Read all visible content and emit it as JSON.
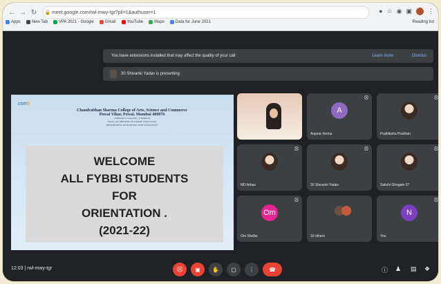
{
  "browser": {
    "url": "meet.google.com/rwl-mwy-tgr?pli=1&authuser=1",
    "bookmarks": [
      "Apps",
      "New Tab",
      "VPA 2021 - Google",
      "Gmail",
      "YouTube",
      "Maps",
      "Data for June 2021"
    ],
    "reading_list": "Reading list"
  },
  "meet": {
    "extension_banner": "You have extensions installed that may affect the quality of your call",
    "learn_more": "Learn more",
    "dismiss": "Dismiss",
    "presenting": "30 Shivanki Yadav is presenting",
    "time": "12:03",
    "meeting_code": "rwl-mwy-tgr"
  },
  "slide": {
    "logo_main": "csm",
    "logo_accent": "b",
    "college": "Chandrabhan Sharma College of Arts, Science and Commerce",
    "address": "Powai Vihar, Powai, Mumbai 400076",
    "sub1": "(Affiliated to University of Mumbai)",
    "sub2": "NAAC ACCREDITED 'B' GRADE (Third Cycle)",
    "sub3": "DEPARTMENT OF BANKING AND INSURANCE",
    "welcome_lines": [
      "WELCOME",
      "ALL FYBBI STUDENTS",
      "FOR",
      "ORIENTATION .",
      "(2021-22)"
    ]
  },
  "participants": [
    {
      "name": "",
      "type": "video"
    },
    {
      "name": "Anjana Verma",
      "type": "letter",
      "letter": "A",
      "color": "#8e6bbf"
    },
    {
      "name": "Prathiksha Pradhan",
      "type": "photo"
    },
    {
      "name": "MD Arbaz",
      "type": "photo"
    },
    {
      "name": "30 Shivanki Yadav",
      "type": "photo"
    },
    {
      "name": "Sakshi Ghogale 07",
      "type": "photo"
    },
    {
      "name": "Om Shelke",
      "type": "letter",
      "letter": "Om",
      "color": "#e52592"
    },
    {
      "name": "10 others",
      "type": "others"
    },
    {
      "name": "You",
      "type": "letter",
      "letter": "N",
      "color": "#7b3fbf"
    }
  ],
  "icons": {
    "mic_off": "⛒",
    "cam_off": "▣",
    "hand": "✋",
    "present": "▢",
    "more": "⋮",
    "hangup": "☎",
    "info": "ⓘ",
    "people": "♟",
    "chat": "▤",
    "activities": "❖"
  }
}
